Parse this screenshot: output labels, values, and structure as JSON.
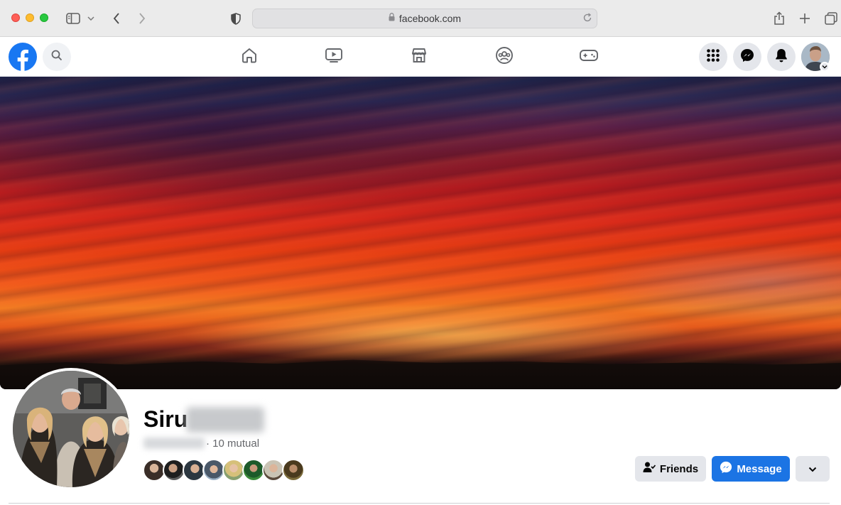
{
  "browser": {
    "url": "facebook.com",
    "traffic_lights": [
      "close",
      "minimize",
      "zoom"
    ],
    "icons": [
      "sidebar-icon",
      "chevron-down-icon",
      "back-icon",
      "forward-icon",
      "shield-icon",
      "lock-icon",
      "reload-icon",
      "share-icon",
      "new-tab-icon",
      "tabs-overview-icon"
    ]
  },
  "fb_nav": {
    "logo": "facebook-logo",
    "tabs": [
      {
        "name": "home",
        "icon": "home-icon"
      },
      {
        "name": "watch",
        "icon": "video-icon"
      },
      {
        "name": "marketplace",
        "icon": "store-icon"
      },
      {
        "name": "groups",
        "icon": "groups-icon"
      },
      {
        "name": "gaming",
        "icon": "gamepad-icon"
      }
    ],
    "right": [
      "menu-grid-icon",
      "messenger-icon",
      "bell-icon",
      "account-avatar"
    ]
  },
  "profile": {
    "name": "Siru",
    "mutual": "· 10 mutual",
    "mutual_friend_avatars": 8
  },
  "actions": {
    "friends_label": "Friends",
    "message_label": "Message"
  },
  "colors": {
    "fb_blue": "#1877f2",
    "message_button": "#1b74e4",
    "secondary_button": "#e4e6eb"
  }
}
